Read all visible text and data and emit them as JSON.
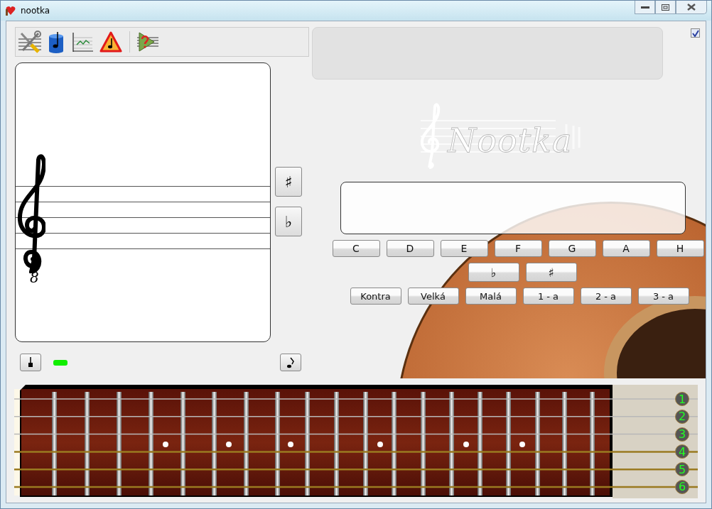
{
  "window": {
    "title": "nootka"
  },
  "staff": {
    "clef_octave": "8"
  },
  "staff_accidentals": [
    "♯",
    "♭"
  ],
  "hints_checkbox": {
    "checked": true
  },
  "logo": {
    "text": "Nootka"
  },
  "note_buttons": [
    "C",
    "D",
    "E",
    "F",
    "G",
    "A",
    "H"
  ],
  "accidental_buttons": [
    "♭",
    "♯"
  ],
  "octave_buttons": [
    "Kontra",
    "Velká",
    "Malá",
    "1 - a",
    "2 - a",
    "3 - a"
  ],
  "fretboard": {
    "strings": [
      "1",
      "2",
      "3",
      "4",
      "5",
      "6"
    ]
  }
}
